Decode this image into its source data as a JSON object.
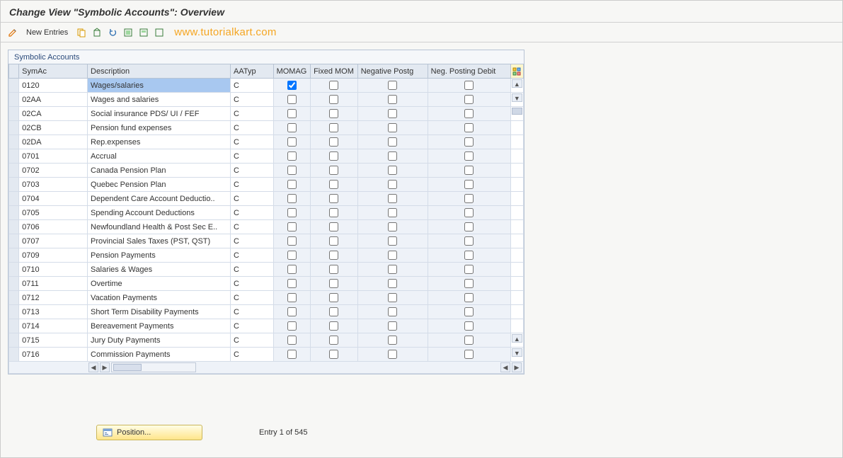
{
  "title": "Change View \"Symbolic Accounts\": Overview",
  "toolbar": {
    "new_entries": "New Entries"
  },
  "watermark": "www.tutorialkart.com",
  "group": {
    "title": "Symbolic Accounts"
  },
  "columns": {
    "symac": "SymAc",
    "description": "Description",
    "aatyp": "AATyp",
    "momag": "MOMAG",
    "fixed_mom": "Fixed MOM",
    "negative_postg": "Negative Postg",
    "neg_posting_debit": "Neg. Posting Debit"
  },
  "rows": [
    {
      "sym": "0120",
      "desc": "Wages/salaries",
      "aaty": "C",
      "momag": true,
      "fixed": false,
      "neg": false,
      "negd": false,
      "selected": true
    },
    {
      "sym": "02AA",
      "desc": "Wages and salaries",
      "aaty": "C",
      "momag": false,
      "fixed": false,
      "neg": false,
      "negd": false
    },
    {
      "sym": "02CA",
      "desc": "Social insurance PDS/ UI / FEF",
      "aaty": "C",
      "momag": false,
      "fixed": false,
      "neg": false,
      "negd": false
    },
    {
      "sym": "02CB",
      "desc": "Pension fund expenses",
      "aaty": "C",
      "momag": false,
      "fixed": false,
      "neg": false,
      "negd": false
    },
    {
      "sym": "02DA",
      "desc": "Rep.expenses",
      "aaty": "C",
      "momag": false,
      "fixed": false,
      "neg": false,
      "negd": false
    },
    {
      "sym": "0701",
      "desc": "Accrual",
      "aaty": "C",
      "momag": false,
      "fixed": false,
      "neg": false,
      "negd": false
    },
    {
      "sym": "0702",
      "desc": "Canada Pension Plan",
      "aaty": "C",
      "momag": false,
      "fixed": false,
      "neg": false,
      "negd": false
    },
    {
      "sym": "0703",
      "desc": "Quebec Pension Plan",
      "aaty": "C",
      "momag": false,
      "fixed": false,
      "neg": false,
      "negd": false
    },
    {
      "sym": "0704",
      "desc": "Dependent Care Account Deductio..",
      "aaty": "C",
      "momag": false,
      "fixed": false,
      "neg": false,
      "negd": false
    },
    {
      "sym": "0705",
      "desc": "Spending Account Deductions",
      "aaty": "C",
      "momag": false,
      "fixed": false,
      "neg": false,
      "negd": false
    },
    {
      "sym": "0706",
      "desc": "Newfoundland Health & Post Sec E..",
      "aaty": "C",
      "momag": false,
      "fixed": false,
      "neg": false,
      "negd": false
    },
    {
      "sym": "0707",
      "desc": "Provincial Sales Taxes (PST, QST)",
      "aaty": "C",
      "momag": false,
      "fixed": false,
      "neg": false,
      "negd": false
    },
    {
      "sym": "0709",
      "desc": "Pension Payments",
      "aaty": "C",
      "momag": false,
      "fixed": false,
      "neg": false,
      "negd": false
    },
    {
      "sym": "0710",
      "desc": "Salaries & Wages",
      "aaty": "C",
      "momag": false,
      "fixed": false,
      "neg": false,
      "negd": false
    },
    {
      "sym": "0711",
      "desc": "Overtime",
      "aaty": "C",
      "momag": false,
      "fixed": false,
      "neg": false,
      "negd": false
    },
    {
      "sym": "0712",
      "desc": "Vacation Payments",
      "aaty": "C",
      "momag": false,
      "fixed": false,
      "neg": false,
      "negd": false
    },
    {
      "sym": "0713",
      "desc": "Short Term Disability Payments",
      "aaty": "C",
      "momag": false,
      "fixed": false,
      "neg": false,
      "negd": false
    },
    {
      "sym": "0714",
      "desc": "Bereavement Payments",
      "aaty": "C",
      "momag": false,
      "fixed": false,
      "neg": false,
      "negd": false
    },
    {
      "sym": "0715",
      "desc": "Jury Duty Payments",
      "aaty": "C",
      "momag": false,
      "fixed": false,
      "neg": false,
      "negd": false
    },
    {
      "sym": "0716",
      "desc": "Commission Payments",
      "aaty": "C",
      "momag": false,
      "fixed": false,
      "neg": false,
      "negd": false
    }
  ],
  "footer": {
    "position_label": "Position...",
    "entry_info": "Entry 1 of 545"
  }
}
